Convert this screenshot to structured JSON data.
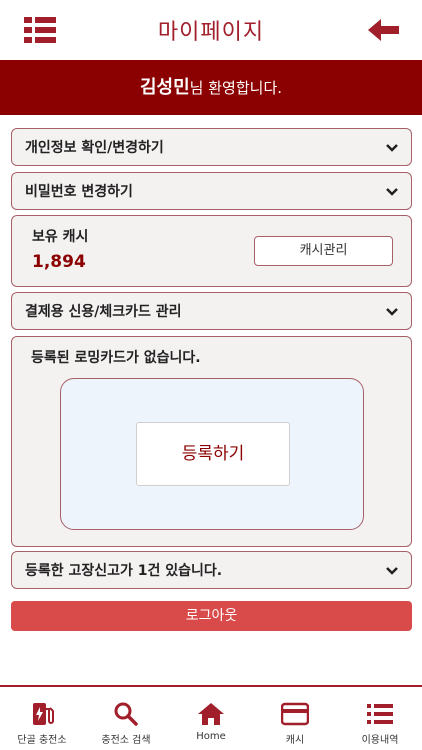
{
  "header": {
    "title": "마이페이지"
  },
  "welcome": {
    "name": "김성민",
    "suffix": "님 환영합니다."
  },
  "sections": {
    "personal_info": "개인정보 확인/변경하기",
    "password": "비밀번호 변경하기",
    "card_manage": "결제용 신용/체크카드 관리",
    "fault_reports": "등록한 고장신고가 1건 있습니다."
  },
  "cash": {
    "title": "보유 캐시",
    "amount": "1,894",
    "manage_label": "캐시관리"
  },
  "roaming": {
    "message": "등록된 로밍카드가 없습니다.",
    "register_label": "등록하기"
  },
  "logout_label": "로그아웃",
  "bottom_nav": [
    {
      "label": "단골 충전소",
      "icon": "charger-icon"
    },
    {
      "label": "충전소 검색",
      "icon": "search-icon"
    },
    {
      "label": "Home",
      "icon": "home-icon"
    },
    {
      "label": "캐시",
      "icon": "card-icon"
    },
    {
      "label": "이용내역",
      "icon": "list-icon"
    }
  ],
  "colors": {
    "brand": "#8b0000",
    "accent": "#a01f2a",
    "logout": "#d94a4a"
  }
}
